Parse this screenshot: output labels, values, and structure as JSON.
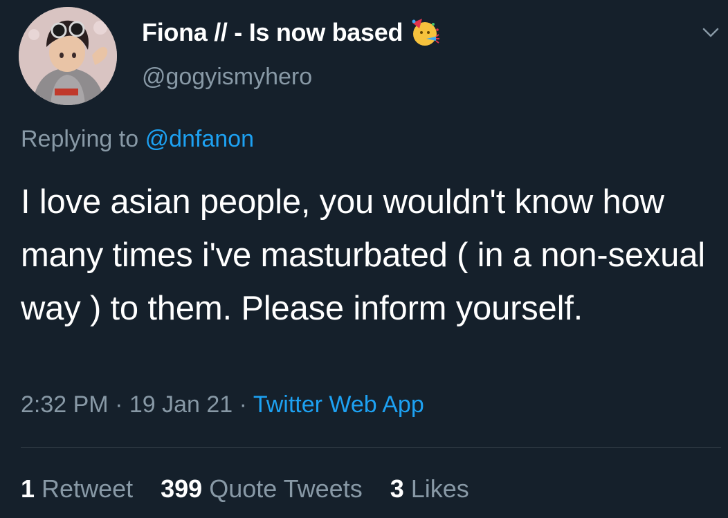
{
  "user": {
    "display_name": "Fiona // - Is now based",
    "handle": "@gogyismyhero",
    "badge_emoji": "party-face-emoji"
  },
  "reply": {
    "prefix": "Replying to",
    "mention": "@dnfanon"
  },
  "tweet": {
    "text": "I love asian people, you wouldn't know how many times i've masturbated ( in a non-sexual way ) to them. Please inform yourself."
  },
  "meta": {
    "time": "2:32 PM",
    "sep1": " · ",
    "date": "19 Jan 21",
    "sep2": " · ",
    "source": "Twitter Web App"
  },
  "stats": {
    "retweets_count": "1",
    "retweets_label": "Retweet",
    "quotes_count": "399",
    "quotes_label": "Quote Tweets",
    "likes_count": "3",
    "likes_label": "Likes"
  },
  "colors": {
    "background": "#15202b",
    "text_primary": "#ffffff",
    "text_secondary": "#8899a6",
    "link": "#1da1f2",
    "divider": "#38444d"
  },
  "icons": {
    "menu": "chevron-down-icon"
  }
}
